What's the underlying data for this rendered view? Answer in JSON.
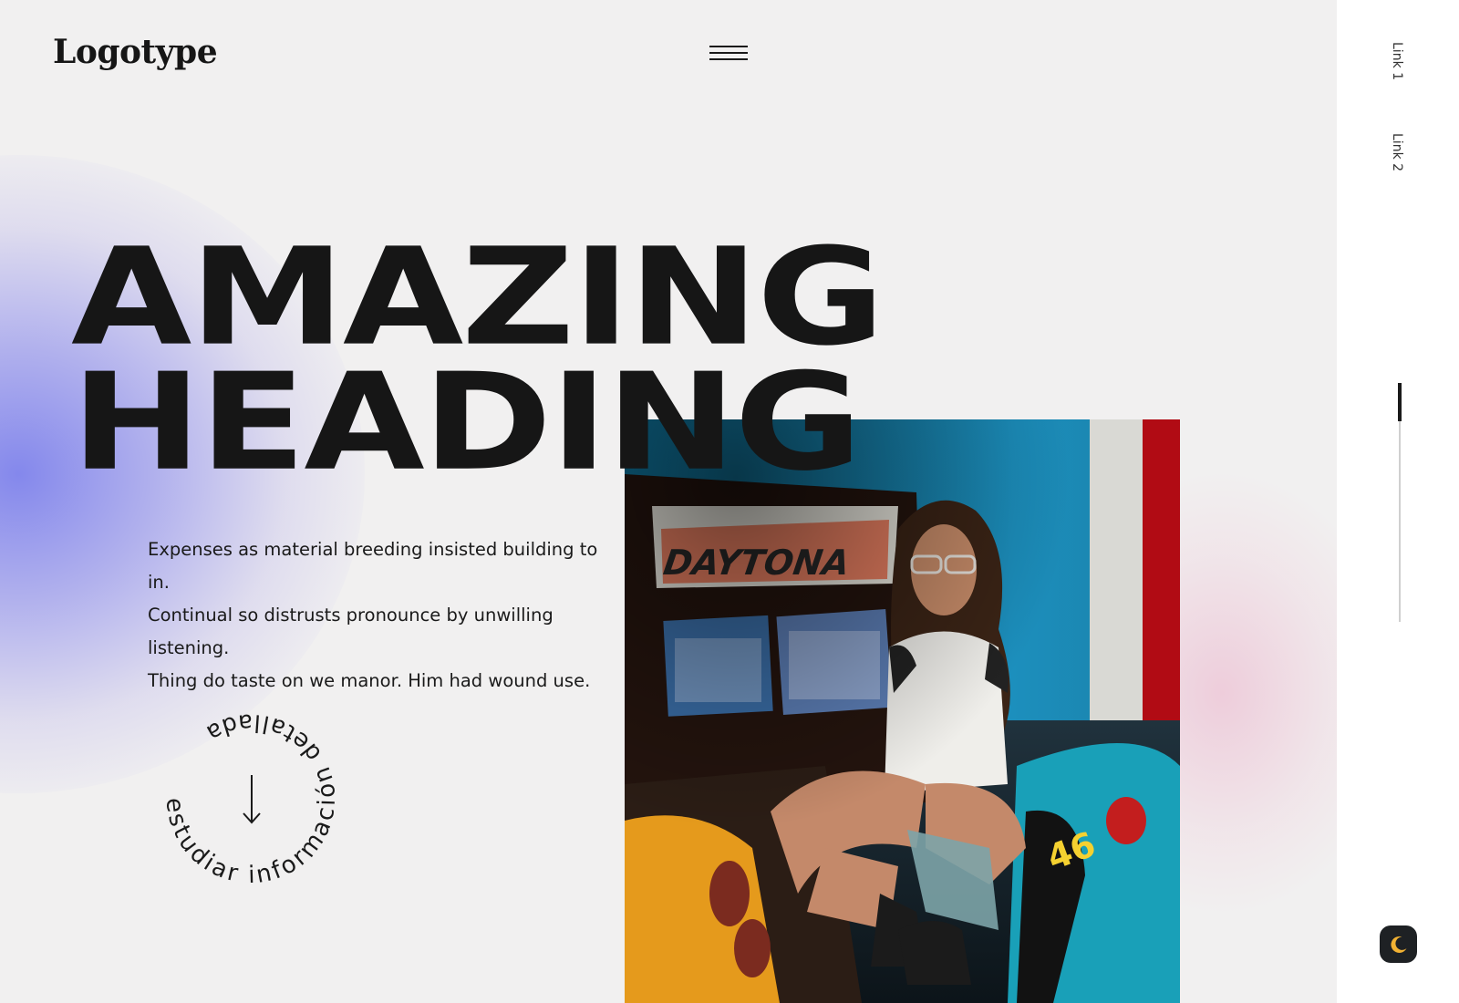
{
  "header": {
    "logo_text": "Logotype",
    "menu_icon": "hamburger-icon"
  },
  "hero": {
    "heading_line1": "AMAZING",
    "heading_line2": "HEADING",
    "paragraph_lines": [
      "Expenses as material breeding insisted building to in.",
      "Continual so distrusts pronounce by unwilling listening.",
      "Thing do taste on we manor. Him had wound use."
    ],
    "circle_text": "estudiar información detallada",
    "circle_icon": "arrow-down-icon",
    "image_alt": "Woman sitting on a racing arcade machine"
  },
  "sidebar": {
    "link1": "Link 1",
    "link2": "Link 2",
    "scroll_progress": 0.16,
    "theme_icon": "moon-icon"
  },
  "colors": {
    "background": "#f1f0f0",
    "text": "#161616",
    "accent_blue": "#7e82ec",
    "accent_pink": "#ecbed2",
    "theme_button": "#1e2124",
    "moon": "#f2b233"
  }
}
